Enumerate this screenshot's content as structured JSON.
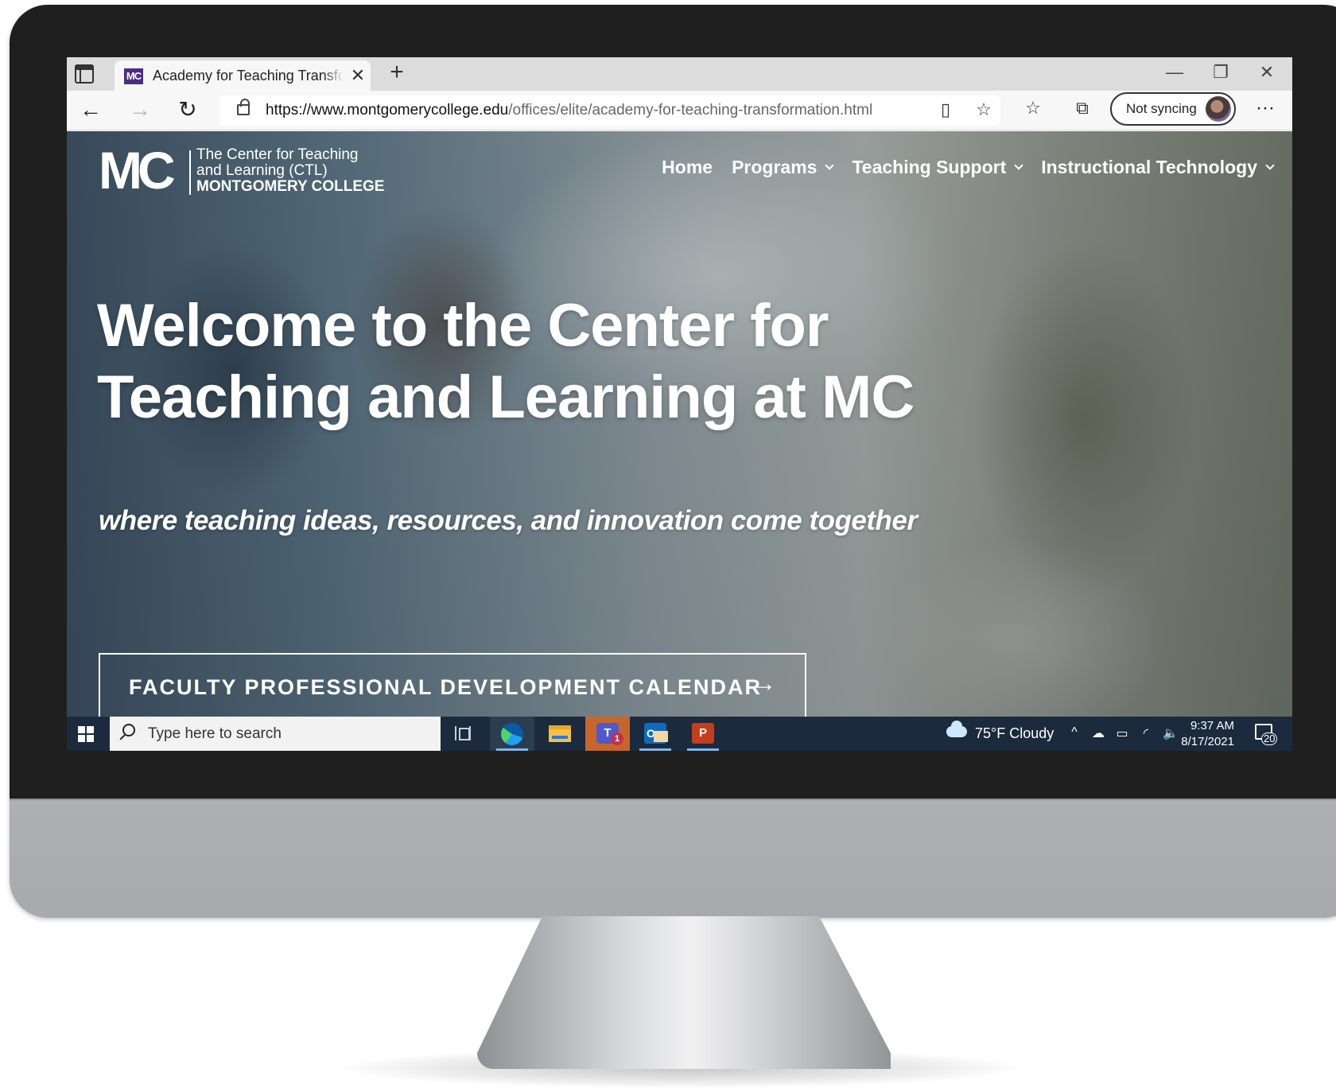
{
  "browser": {
    "tab": {
      "favicon_text": "MC",
      "title": "Academy for Teaching Transformation",
      "close_glyph": "✕"
    },
    "new_tab_glyph": "+",
    "window_controls": {
      "minimize": "—",
      "restore": "❐",
      "close": "✕"
    },
    "nav": {
      "back": "←",
      "forward": "→",
      "refresh": "↻"
    },
    "address": {
      "url_host": "https://www.montgomerycollege.edu",
      "url_path": "/offices/elite/academy-for-teaching-transformation.html"
    },
    "sync_label": "Not syncing",
    "more_glyph": "···"
  },
  "site": {
    "logo": {
      "mark": "MC",
      "line1": "The Center for Teaching",
      "line2": "and Learning (CTL)",
      "line3": "MONTGOMERY COLLEGE"
    },
    "nav": [
      {
        "label": "Home",
        "dropdown": false
      },
      {
        "label": "Programs",
        "dropdown": true
      },
      {
        "label": "Teaching Support",
        "dropdown": true
      },
      {
        "label": "Instructional Technology",
        "dropdown": true
      }
    ],
    "hero": {
      "headline_line1": "Welcome to the Center for",
      "headline_line2": "Teaching and Learning at MC",
      "tagline": "where teaching ideas, resources, and innovation come together",
      "cta_label": "FACULTY PROFESSIONAL DEVELOPMENT CALENDAR",
      "cta_arrow": "→"
    }
  },
  "taskbar": {
    "search_placeholder": "Type here to search",
    "apps": [
      {
        "name": "Microsoft Edge",
        "icon": "edge-icon",
        "active": true
      },
      {
        "name": "File Explorer",
        "icon": "folder-icon",
        "active": false
      },
      {
        "name": "Microsoft Teams",
        "icon": "teams-icon",
        "active": false,
        "badge": "1",
        "label": "T"
      },
      {
        "name": "Outlook",
        "icon": "outlook-icon",
        "active": true,
        "label": "O"
      },
      {
        "name": "PowerPoint",
        "icon": "powerpoint-icon",
        "active": true,
        "label": "P"
      }
    ],
    "weather": "75°F  Cloudy",
    "tray_glyphs": {
      "chevron": "^",
      "cloud": "☁",
      "battery": "▭",
      "wifi": "◜",
      "volume": "🔈"
    },
    "time": "9:37 AM",
    "date": "8/17/2021",
    "notifications": "20"
  },
  "colors": {
    "brand_purple": "#4b2e83",
    "taskbar": "#1b2a3c",
    "bezel": "#1f1f1f"
  }
}
